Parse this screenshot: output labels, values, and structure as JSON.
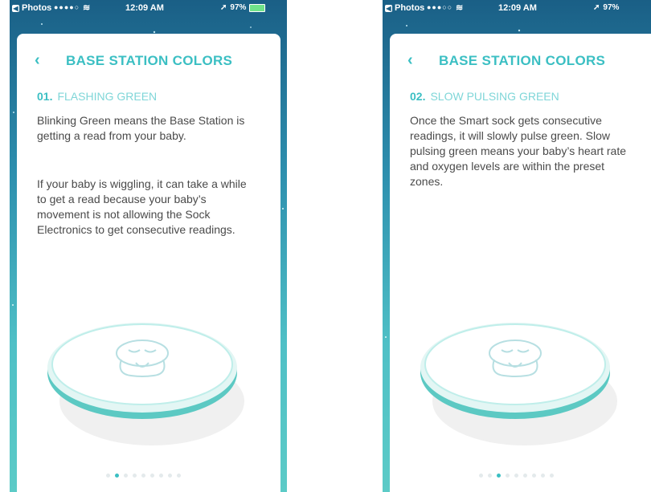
{
  "status_bar": {
    "back_app": "Photos",
    "time": "12:09 AM",
    "battery": "97%"
  },
  "screens": [
    {
      "title": "BASE STATION COLORS",
      "step_number": "01.",
      "step_name": "FLASHING GREEN",
      "paragraph_1": "Blinking Green means the Base Station is getting a read from your baby.",
      "paragraph_2": "If your baby is wiggling, it can take a while to get a read because your baby’s movement is not allowing the Sock Electronics to get consecutive readings.",
      "active_page": 2,
      "total_pages": 9
    },
    {
      "title": "BASE STATION COLORS",
      "step_number": "02.",
      "step_name": "SLOW PULSING GREEN",
      "paragraph_1": "Once the Smart sock gets consecutive readings, it will slowly pulse green. Slow pulsing green means your baby’s heart rate and oxygen levels are within the preset zones.",
      "paragraph_2": "",
      "active_page": 3,
      "total_pages": 9
    }
  ],
  "colors": {
    "accent": "#3bbfc3",
    "step_name": "#7fd6d8",
    "body_text": "#4a4a4a",
    "background_top": "#1a5f86",
    "background_bottom": "#5ccbc7"
  },
  "icons": {
    "back": "chevron-left-icon",
    "wifi": "wifi-icon",
    "location": "location-arrow-icon",
    "battery": "battery-icon",
    "illustration": "base-station-owl"
  }
}
